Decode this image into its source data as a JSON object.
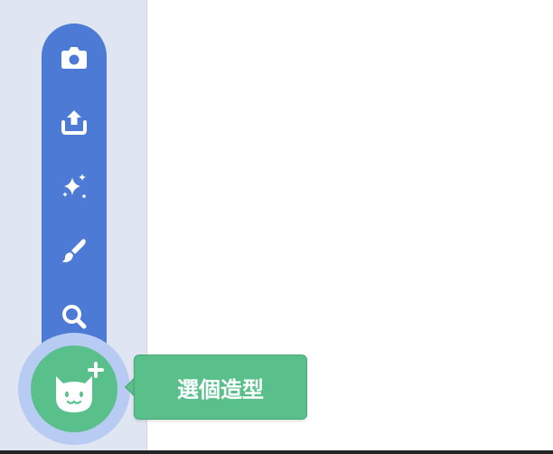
{
  "colors": {
    "panel": "#e0e6f1",
    "menu": "#4c7ad5",
    "accent": "#59c08c",
    "halo": "#b7cbf3"
  },
  "menu": {
    "items": [
      {
        "icon": "camera-icon"
      },
      {
        "icon": "upload-icon"
      },
      {
        "icon": "surprise-sparkle-icon"
      },
      {
        "icon": "paint-brush-icon"
      },
      {
        "icon": "search-icon"
      }
    ]
  },
  "main_button": {
    "icon": "cat-plus-icon"
  },
  "tooltip": {
    "label": "選個造型"
  }
}
